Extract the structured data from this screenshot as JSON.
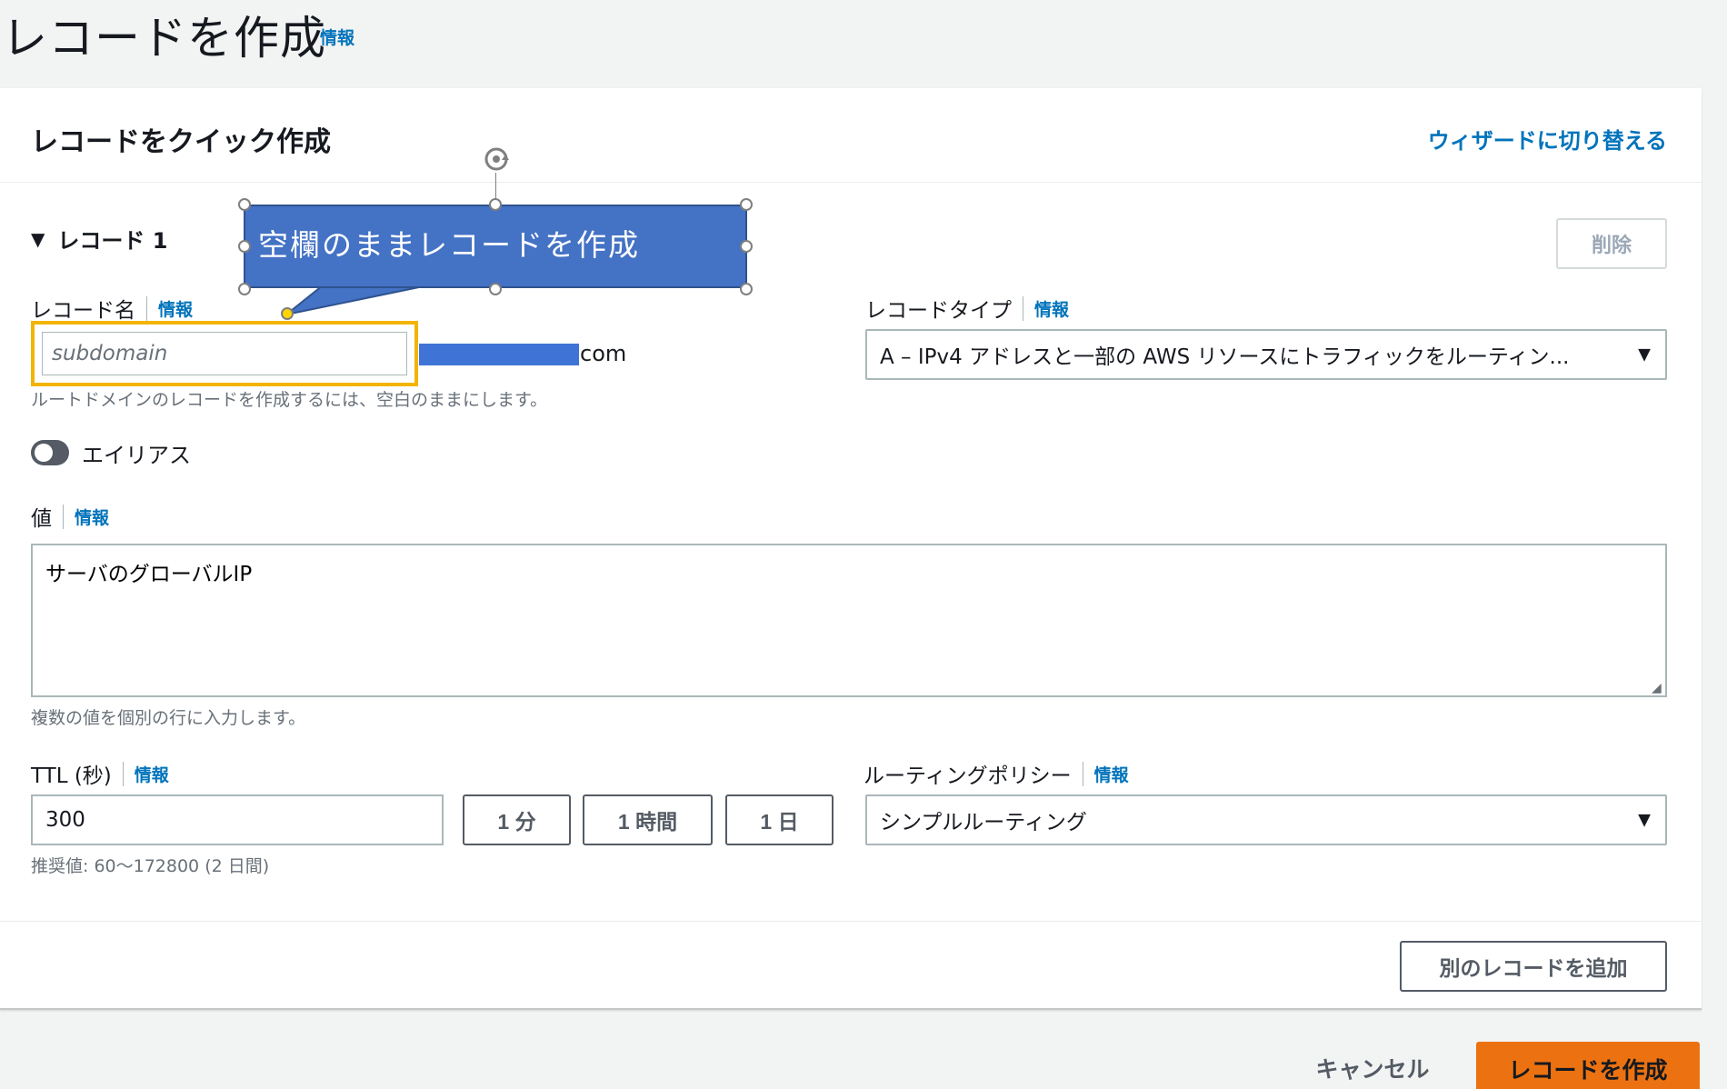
{
  "page": {
    "title": "レコードを作成",
    "info": "情報"
  },
  "card": {
    "title": "レコードをクイック作成",
    "wizard_link": "ウィザードに切り替える"
  },
  "record": {
    "section_label": "レコード 1",
    "delete_label": "削除",
    "name_label": "レコード名",
    "name_info": "情報",
    "name_placeholder": "subdomain",
    "domain_suffix": "com",
    "name_hint": "ルートドメインのレコードを作成するには、空白のままにします。",
    "type_label": "レコードタイプ",
    "type_info": "情報",
    "type_value": "A – IPv4 アドレスと一部の AWS リソースにトラフィックをルーティン...",
    "alias_label": "エイリアス",
    "value_label": "値",
    "value_info": "情報",
    "value_text": "サーバのグローバルIP",
    "value_hint": "複数の値を個別の行に入力します。",
    "ttl_label": "TTL (秒)",
    "ttl_info": "情報",
    "ttl_value": "300",
    "ttl_hint": "推奨値: 60～172800 (2 日間)",
    "ttl_quick": [
      "1 分",
      "1 時間",
      "1 日"
    ],
    "routing_label": "ルーティングポリシー",
    "routing_info": "情報",
    "routing_value": "シンプルルーティング"
  },
  "actions": {
    "add_record": "別のレコードを追加",
    "cancel": "キャンセル",
    "create": "レコードを作成"
  },
  "annotation": {
    "callout_text": "空欄のままレコードを作成"
  },
  "colors": {
    "accent": "#0073bb",
    "primary_button": "#ec7211",
    "callout": "#4472c4",
    "highlight": "#f2b400"
  }
}
